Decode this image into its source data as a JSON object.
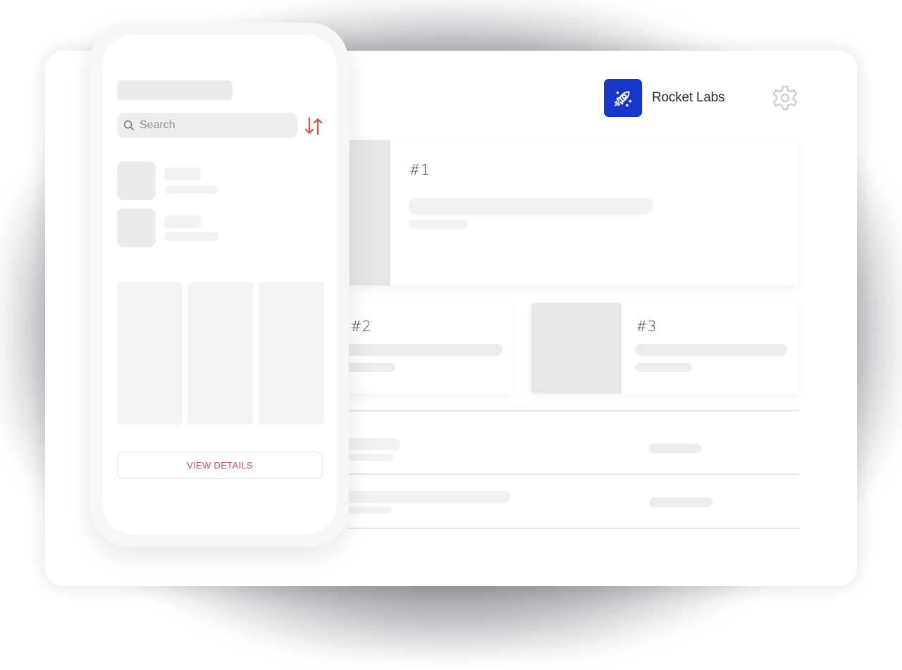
{
  "brand": {
    "name": "Rocket Labs",
    "logo_icon": "rocket-icon",
    "logo_color": "#1537c9"
  },
  "header": {
    "settings_icon": "gear-icon"
  },
  "featured": [
    {
      "label": "#1"
    },
    {
      "label": "#2"
    },
    {
      "label": "#3"
    }
  ],
  "phone": {
    "search": {
      "placeholder": "Search",
      "value": ""
    },
    "sort_icon": "sort-arrows-icon",
    "view_details_label": "VIEW DETAILS",
    "accent_color": "#c9535a"
  }
}
